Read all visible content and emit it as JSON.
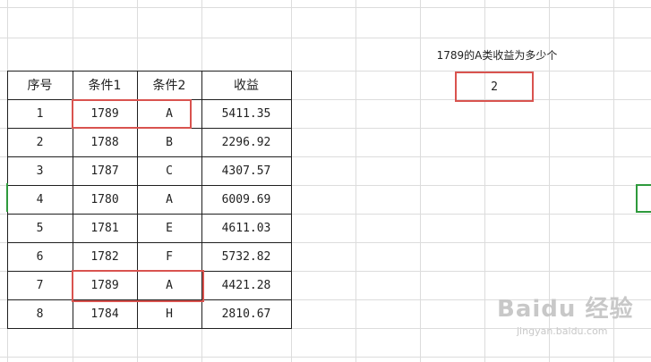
{
  "table": {
    "headers": [
      "序号",
      "条件1",
      "条件2",
      "收益"
    ],
    "rows": [
      [
        "1",
        "1789",
        "A",
        "5411.35"
      ],
      [
        "2",
        "1788",
        "B",
        "2296.92"
      ],
      [
        "3",
        "1787",
        "C",
        "4307.57"
      ],
      [
        "4",
        "1780",
        "A",
        "6009.69"
      ],
      [
        "5",
        "1781",
        "E",
        "4611.03"
      ],
      [
        "6",
        "1782",
        "F",
        "5732.82"
      ],
      [
        "7",
        "1789",
        "A",
        "4421.28"
      ],
      [
        "8",
        "1784",
        "H",
        "2810.67"
      ]
    ]
  },
  "question": "1789的A类收益为多少个",
  "answer": "2",
  "watermark": {
    "brand": "Baidu 经验",
    "site": "jingyan.baidu.com"
  },
  "colors": {
    "highlight": "#d9534f",
    "selection_marker": "#2e9a3c",
    "gridline": "#dcdcdc",
    "table_border": "#1f1f1f"
  }
}
